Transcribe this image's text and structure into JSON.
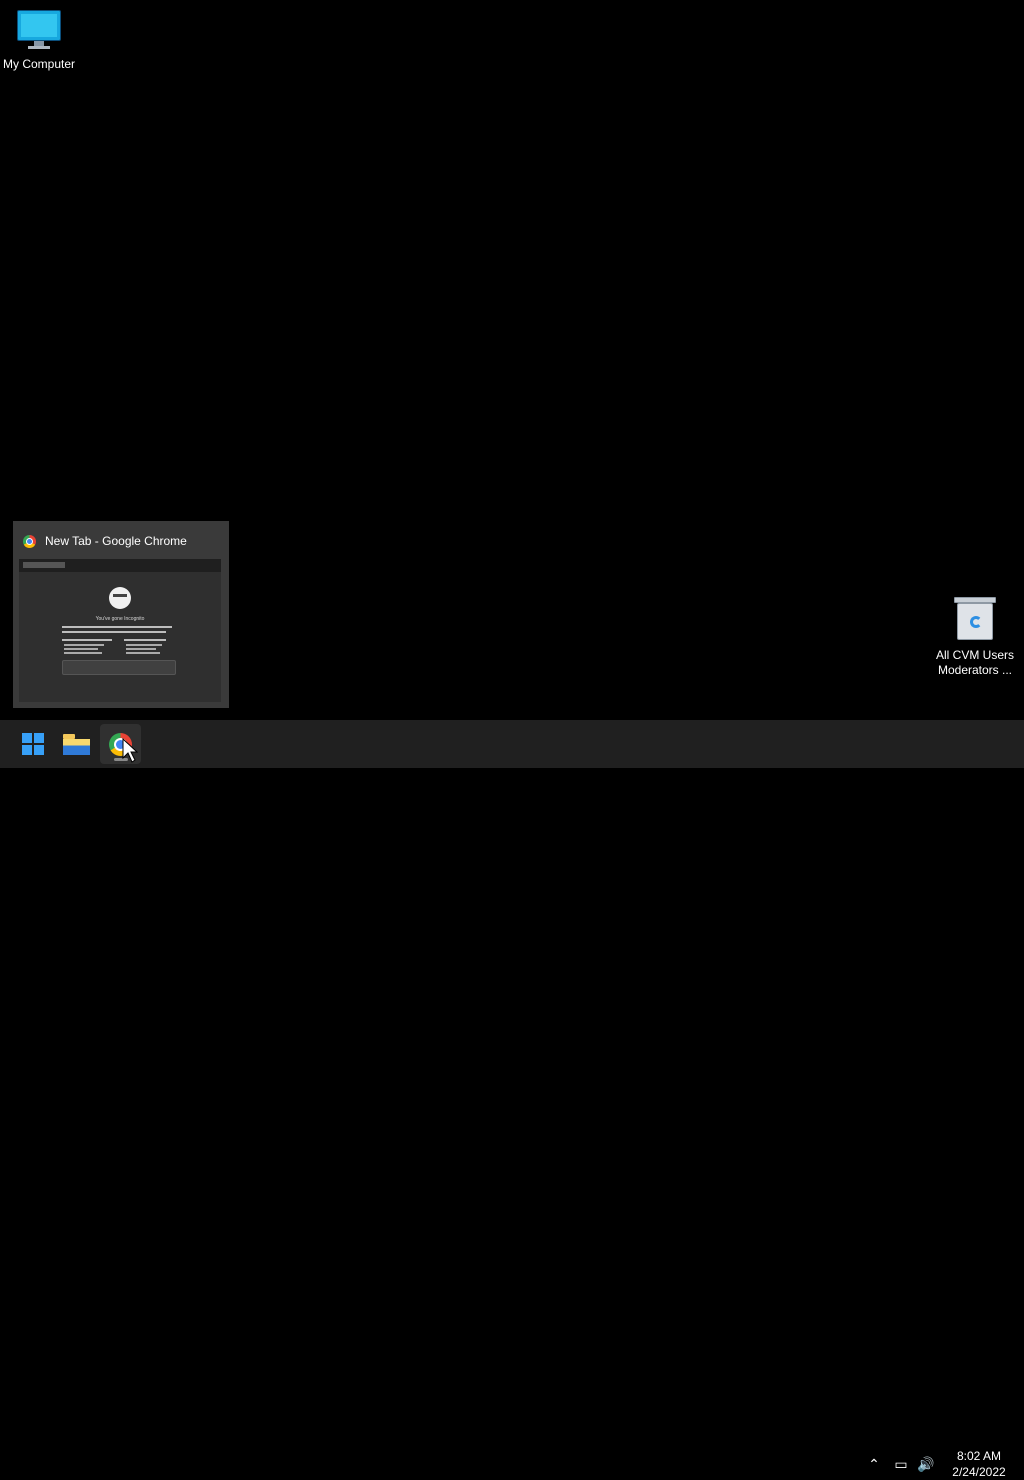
{
  "desktop": {
    "icons": [
      {
        "label": "My Computer"
      },
      {
        "label_line1": "All CVM Users",
        "label_line2": "Moderators ..."
      }
    ]
  },
  "preview": {
    "title": "New Tab - Google Chrome",
    "incognito_title": "You've gone Incognito"
  },
  "taskbar": {
    "apps": [
      "Start",
      "File Explorer",
      "Google Chrome"
    ],
    "time": "8:02 AM",
    "date": "2/24/2022"
  },
  "icons": {
    "computer": "monitor-icon",
    "recycle": "recycle-bin-icon",
    "chrome": "chrome-icon",
    "explorer": "folder-icon",
    "start": "windows-logo-icon"
  },
  "colors": {
    "desktop": "#000000",
    "taskbar": "#202020",
    "preview": "#3a3a3a",
    "accent": "#37a0f7"
  }
}
